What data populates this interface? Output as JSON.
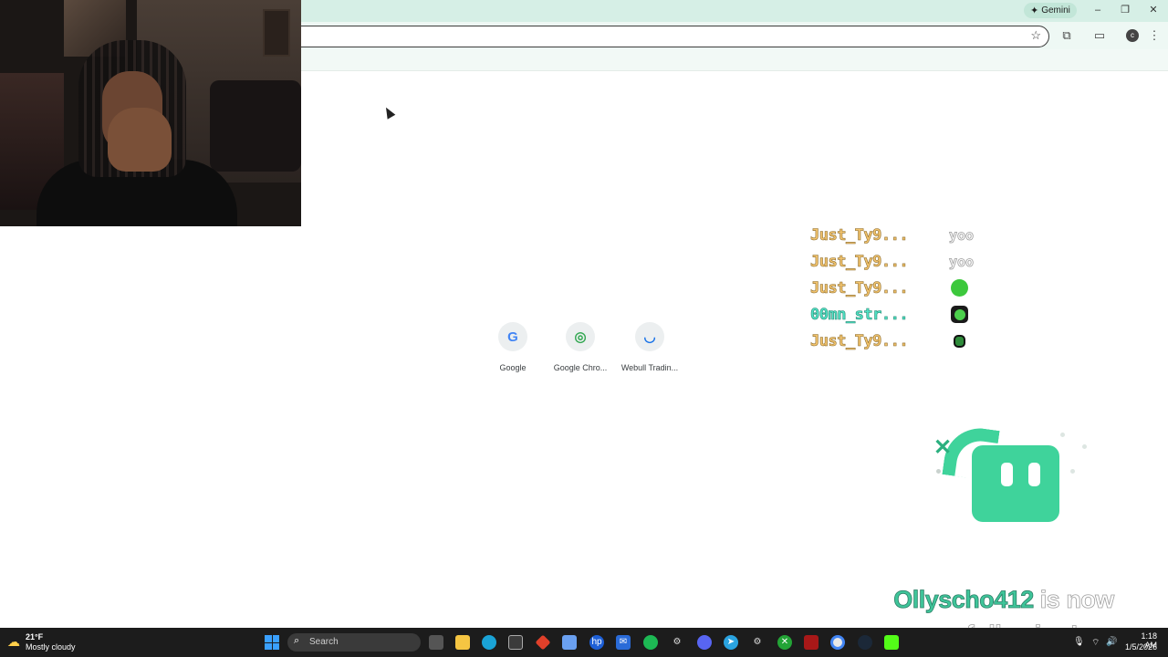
{
  "browser": {
    "gemini_label": "Gemini",
    "window_controls": [
      "–",
      "❐",
      "✕"
    ],
    "toolbar_icons": [
      "extensions-icon",
      "tab-search-icon",
      "profile-avatar",
      "menu-icon"
    ],
    "profile_initial": "c"
  },
  "new_tab": {
    "shortcuts": [
      {
        "label": "Google",
        "glyph": "G",
        "color": "#4285f4"
      },
      {
        "label": "Google Chro...",
        "glyph": "◎",
        "color": "#34a853"
      },
      {
        "label": "Webull Tradin...",
        "glyph": "◡",
        "color": "#1a73e8"
      }
    ]
  },
  "chat": {
    "messages": [
      {
        "user": "Just_Ty9...",
        "user_color": "#f3c46e",
        "text": "yoo"
      },
      {
        "user": "Just_Ty9...",
        "user_color": "#f3c46e",
        "text": "yoo"
      },
      {
        "user": "Just_Ty9...",
        "user_color": "#f3c46e",
        "emote": "green-frog-emote"
      },
      {
        "user": "00mn_str...",
        "user_color": "#4fe0c2",
        "emote": "frog-sunglasses-emote"
      },
      {
        "user": "Just_Ty9...",
        "user_color": "#f3c46e",
        "emote": "green-gremlin-emote"
      }
    ]
  },
  "alert": {
    "name": "Ollyscho412",
    "line1_rest": "is now",
    "line2": "following!",
    "accent": "#3fd39b"
  },
  "taskbar": {
    "weather_temp": "21°F",
    "weather_cond": "Mostly cloudy",
    "search_placeholder": "Search",
    "time": "1:18 AM",
    "date": "1/5/2026"
  }
}
